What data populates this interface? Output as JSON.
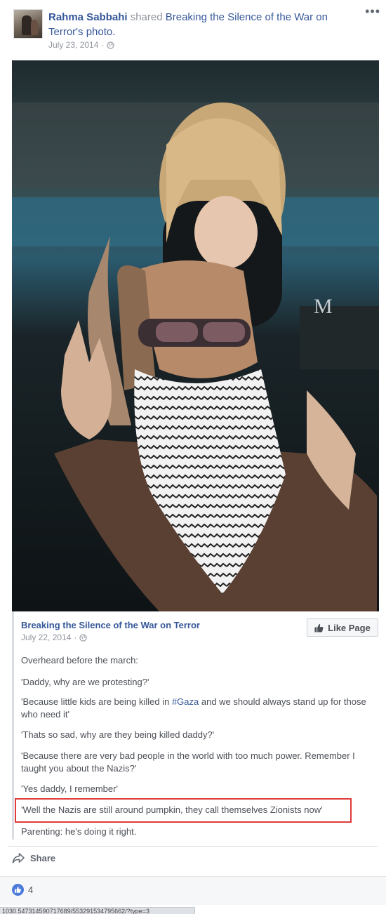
{
  "post": {
    "author": "Rahma Sabbahi",
    "shared_word": "shared",
    "shared_source": "Breaking the Silence of the War on Terror's photo.",
    "date": "July 23, 2014",
    "date_separator": "·",
    "more_label": "•••"
  },
  "shared_page": {
    "name": "Breaking the Silence of the War on Terror",
    "date": "July 22, 2014",
    "date_separator": "·",
    "like_page_label": "Like Page",
    "paragraphs": {
      "p1": "Overheard before the march:",
      "p2": "'Daddy, why are we protesting?'",
      "p3_before": "'Because little kids are being killed in ",
      "p3_hashtag": "#Gaza",
      "p3_after": " and we should always stand up for those who need it'",
      "p4": "'Thats so sad, why are they being killed daddy?'",
      "p5": "'Because there are very bad people in the world with too much power. Remember I taught you about the Nazis?'",
      "p6": "'Yes daddy, I remember'",
      "p7": "'Well the Nazis are still around pumpkin, they call themselves Zionists now'",
      "p8": "Parenting: he's doing it right."
    }
  },
  "actions": {
    "share_label": "Share",
    "like_count": "4"
  },
  "status_bar": {
    "url": "1030.547314590717689/553291534795662/?type=3"
  },
  "colors": {
    "link": "#365899",
    "meta": "#90949c",
    "highlight": "#e03a3a"
  }
}
